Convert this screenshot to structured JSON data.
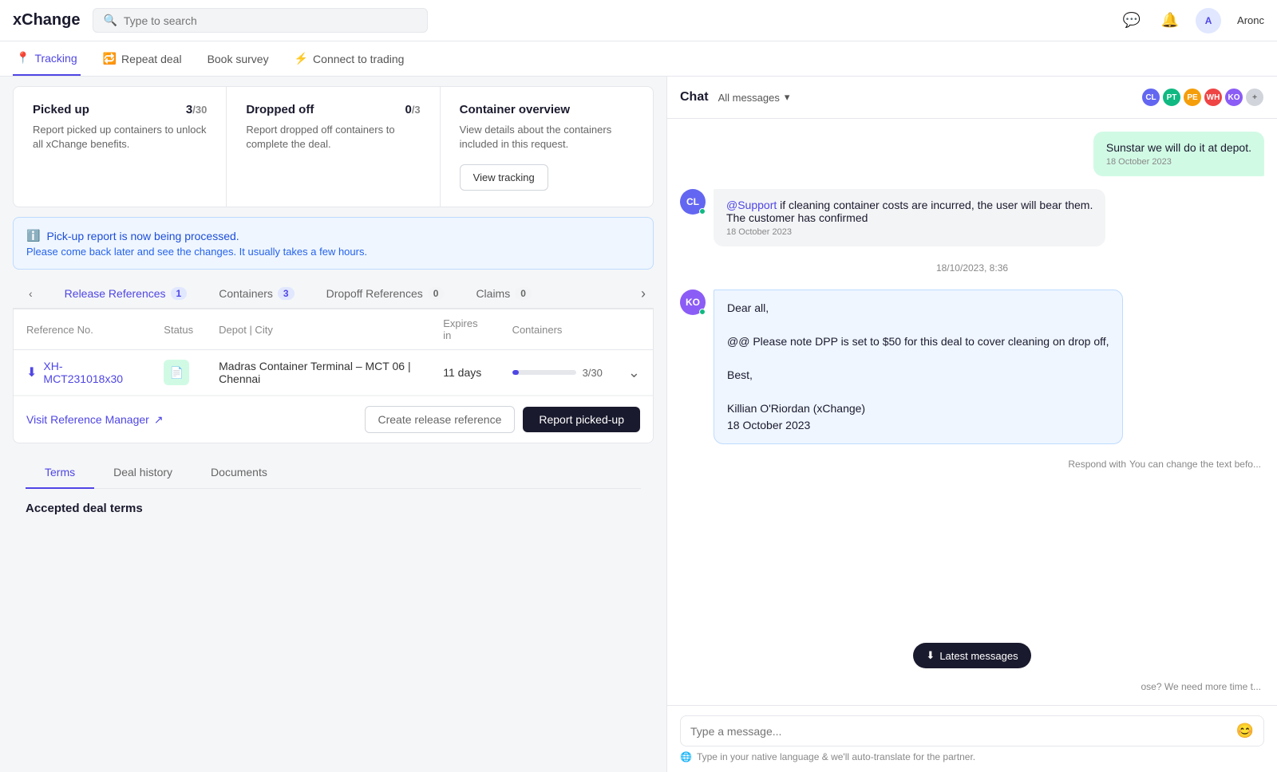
{
  "app": {
    "name": "xChange",
    "search_placeholder": "Type to search"
  },
  "topnav": {
    "logo": "xChange",
    "username": "Aronc"
  },
  "subnav": {
    "items": [
      {
        "label": "Tracking",
        "active": true
      },
      {
        "label": "Repeat deal",
        "active": false
      },
      {
        "label": "Book survey",
        "active": false
      },
      {
        "label": "Connect to trading",
        "active": false
      }
    ]
  },
  "stats": {
    "picked_up": {
      "title": "Picked up",
      "count": "3",
      "total": "30",
      "desc": "Report picked up containers to unlock all xChange benefits."
    },
    "dropped_off": {
      "title": "Dropped off",
      "count": "0",
      "total": "3",
      "desc": "Report dropped off containers to complete the deal."
    },
    "container_overview": {
      "title": "Container overview",
      "desc": "View details about the containers included in this request.",
      "btn": "View tracking"
    }
  },
  "info_banner": {
    "title": "Pick-up report is now being processed.",
    "desc": "Please come back later and see the changes. It usually takes a few hours."
  },
  "release_refs": {
    "section_title": "Release References",
    "badge": "1",
    "tabs": [
      {
        "label": "Release References",
        "count": "1",
        "active": true
      },
      {
        "label": "Containers",
        "count": "3",
        "active": false
      },
      {
        "label": "Dropoff References",
        "count": "0",
        "active": false
      },
      {
        "label": "Claims",
        "count": "0",
        "active": false
      }
    ],
    "table": {
      "columns": [
        "Reference No.",
        "Status",
        "Depot | City",
        "Expires in",
        "Containers"
      ],
      "rows": [
        {
          "ref_no": "XH-MCT231018x30",
          "depot": "Madras Container Terminal – MCT 06 | Chennai",
          "expires": "11 days",
          "containers_filled": 3,
          "containers_total": 30,
          "progress_pct": 10
        }
      ]
    },
    "visit_ref_label": "Visit Reference Manager",
    "create_release_ref": "Create release reference",
    "report_pickup": "Report picked-up"
  },
  "bottom_tabs": {
    "tabs": [
      {
        "label": "Terms",
        "active": true
      },
      {
        "label": "Deal history",
        "active": false
      },
      {
        "label": "Documents",
        "active": false
      }
    ],
    "accepted_terms_title": "Accepted deal terms"
  },
  "chat": {
    "title": "Chat",
    "filter_label": "All messages",
    "avatars": [
      {
        "initials": "CL",
        "color": "#6366f1"
      },
      {
        "initials": "PT",
        "color": "#10b981"
      },
      {
        "initials": "PE",
        "color": "#f59e0b"
      },
      {
        "initials": "WH",
        "color": "#ef4444"
      },
      {
        "initials": "KO",
        "color": "#8b5cf6"
      }
    ],
    "messages": [
      {
        "id": 1,
        "type": "right",
        "text": "Sunstar we will do it at depot.",
        "time": "18 October 2023",
        "bg": "#d1fae5"
      },
      {
        "id": 2,
        "type": "left",
        "avatar_initials": "CL",
        "avatar_color": "#6366f1",
        "text": "@Support if cleaning container costs are incurred, the user will bear them.\nThe customer has confirmed",
        "time": "18 October 2023"
      },
      {
        "id": 3,
        "type": "date_divider",
        "text": "18/10/2023, 8:36"
      },
      {
        "id": 4,
        "type": "left_highlight",
        "avatar_initials": "KO",
        "avatar_color": "#8b5cf6",
        "body": "Dear all,\n\n@@ Please note DPP is set to $50 for this deal to cover cleaning on drop off,\n\nBest,\n\nKillian O'Riordan (xChange)\n18 October 2023"
      }
    ],
    "respond_hint": "Respond with",
    "respond_hint2": "You can change the text befo...",
    "latest_messages_btn": "Latest messages",
    "chat_action_suffix": "ose? We need more time t...",
    "input_placeholder": "Type a message...",
    "translate_hint": "Type in your native language & we'll auto-translate for the partner."
  }
}
